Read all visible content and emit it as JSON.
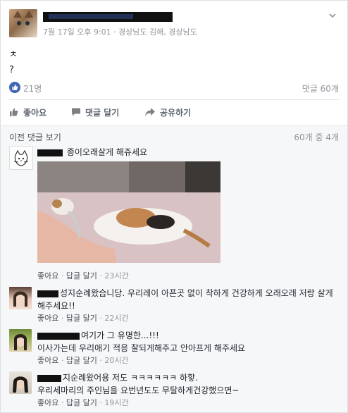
{
  "post": {
    "meta": "7월 17일 오후 9:01 · 경상남도 김해, 경상남도",
    "text_lines": [
      "ㅊ",
      "?"
    ],
    "likes": "21명",
    "comments": "댓글 60개"
  },
  "actions": {
    "like": "좋아요",
    "comment": "댓글 달기",
    "share": "공유하기"
  },
  "comments_header": {
    "prev": "이전 댓글 보기",
    "count": "60개 중 4개"
  },
  "comments": [
    {
      "name_partial": "",
      "text": "종이오래살게 해쥬세요",
      "like": "좋아요",
      "reply": "답글 달기",
      "time": "23시간"
    },
    {
      "name_partial": "",
      "text": "성지순례왔습니당. 우리레이 아픈곳 없이 착하게 건강하게 오래오래 저랑 살게 해주세요!!",
      "like": "좋아요",
      "reply": "답글 달기",
      "time": "22시간"
    },
    {
      "name_partial": "",
      "text_line1": "여기가 그 유명한...!!!",
      "text_line2": "이사가는데 우리애기 적응 잘되게해주고 안아프게 해주세요",
      "like": "좋아요",
      "reply": "답글 달기",
      "time": "20시간"
    },
    {
      "name_partial": "",
      "text_line1": "지순례왔어용 저도 ㅋㅋㅋㅋㅋㅋ 하핳.",
      "text_line2": "우리세마리의 주인님을 요번년도도 무탈하게건강했으면~",
      "like": "좋아요",
      "reply": "답글 달기",
      "time": "19시간"
    }
  ],
  "colors": {
    "link": "#365899",
    "meta": "#90949c",
    "like_blue": "#4267b2"
  },
  "icons": [
    "chevron-down-icon",
    "like-badge-icon",
    "thumbs-up-icon",
    "comment-icon",
    "share-icon"
  ]
}
